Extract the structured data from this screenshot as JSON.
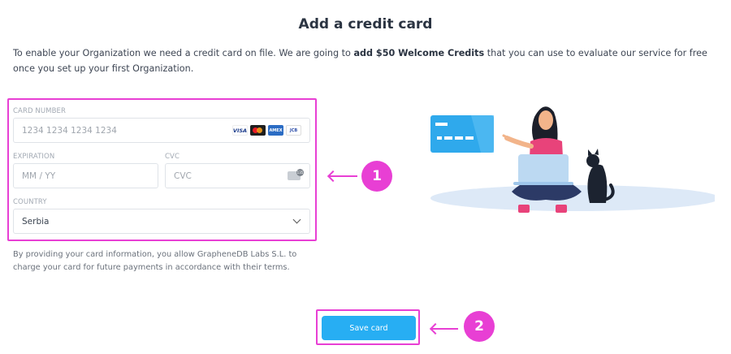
{
  "page": {
    "title": "Add a credit card",
    "intro_before": "To enable your Organization we need a credit card on file. We are going to ",
    "intro_bold": "add $50 Welcome Credits",
    "intro_after": " that you can use to evaluate our service for free once you set up your first Organization."
  },
  "form": {
    "card_number_label": "CARD NUMBER",
    "card_number_placeholder": "1234 1234 1234 1234",
    "expiration_label": "EXPIRATION",
    "expiration_placeholder": "MM / YY",
    "cvc_label": "CVC",
    "cvc_placeholder": "CVC",
    "country_label": "COUNTRY",
    "country_value": "Serbia",
    "card_logos": [
      "VISA",
      "Mastercard",
      "AMEX",
      "JCB"
    ]
  },
  "disclaimer": "By providing your card information, you allow GrapheneDB Labs S.L. to charge your card for future payments in accordance with their terms.",
  "actions": {
    "save_label": "Save card"
  },
  "annotations": {
    "step_1": "1",
    "step_2": "2",
    "highlight_color": "#e83fd4"
  },
  "colors": {
    "primary_button": "#27aef3",
    "illustration_card": "#2fa9ec"
  }
}
